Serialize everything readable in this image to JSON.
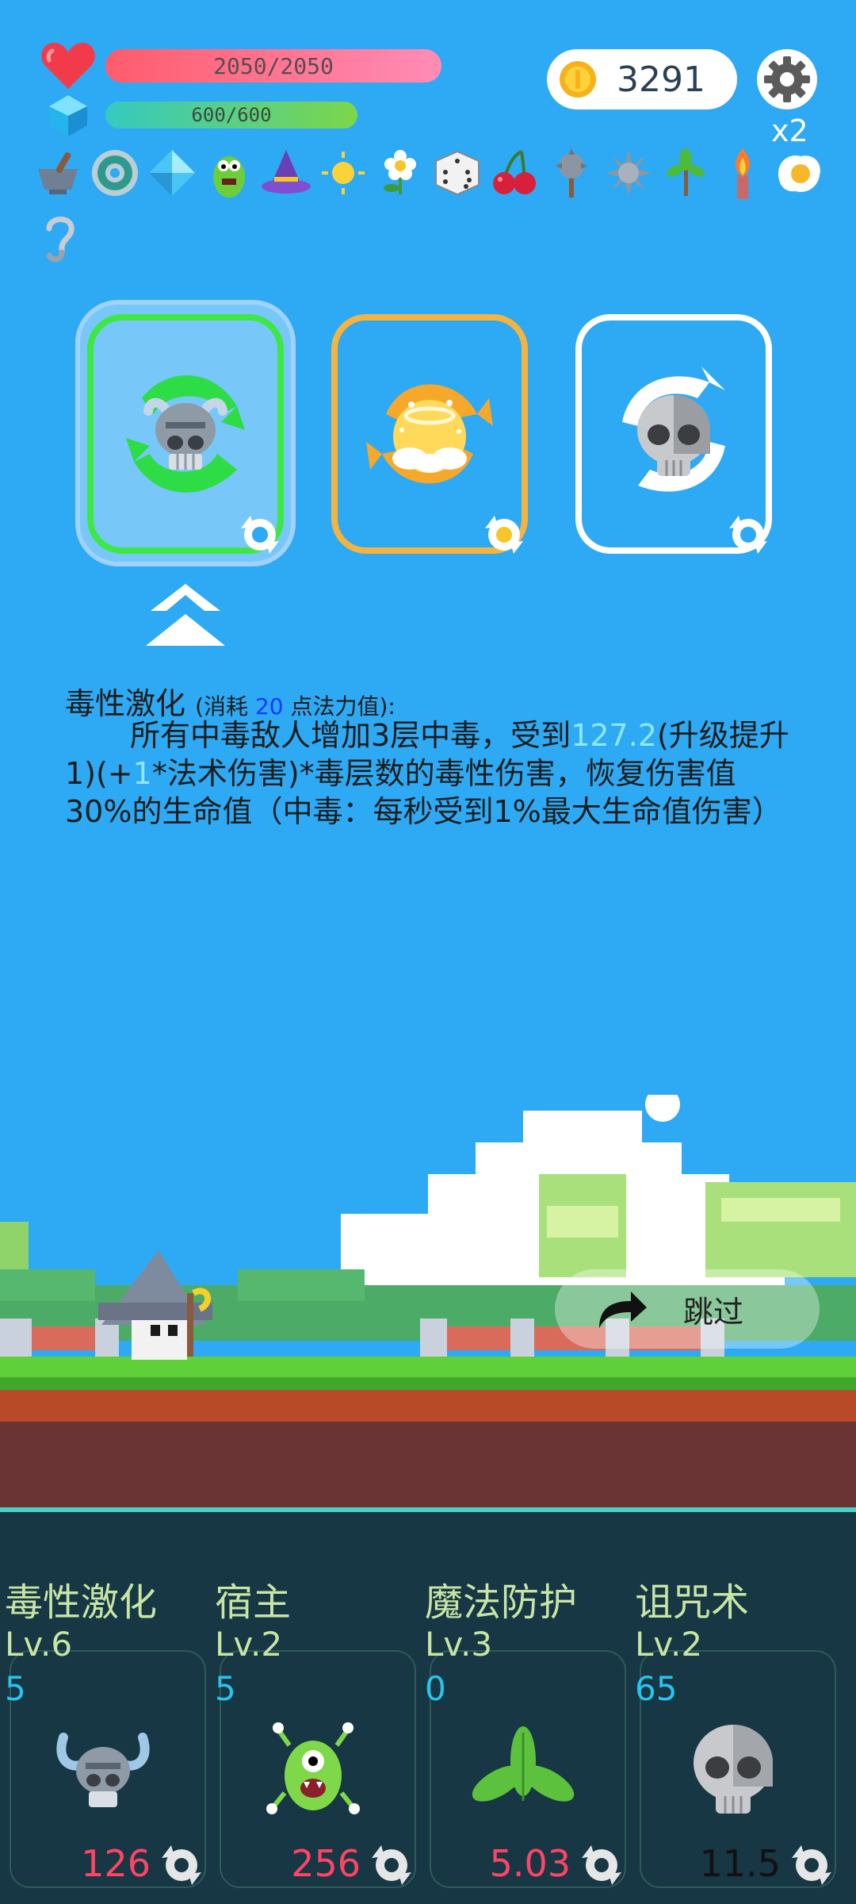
{
  "hud": {
    "hp_text": "2050/2050",
    "hp_fraction": 1.0,
    "mp_text": "600/600",
    "mp_fraction": 1.0,
    "coins": "3291",
    "multiplier": "x2"
  },
  "items": [
    "mortar-icon",
    "ring-icon",
    "gem-icon",
    "goblin-icon",
    "wizard-hat-icon",
    "sun-icon",
    "flower-icon",
    "dice-icon",
    "cherry-icon",
    "spiked-mace-icon",
    "spiked-ball-icon",
    "sapling-icon",
    "torch-icon",
    "egg-icon",
    "hook-icon"
  ],
  "choices": [
    {
      "name": "viking-skull-poison",
      "border": "#3ee844"
    },
    {
      "name": "halo-angel",
      "border": "#f4b43f"
    },
    {
      "name": "grey-skull",
      "border": "#ffffff"
    }
  ],
  "description": {
    "title": "毒性激化",
    "cost_prefix": "(消耗 ",
    "cost_value": "20",
    "cost_suffix": " 点法力值):",
    "body_1": "所有中毒敌人增加3层中毒，受到",
    "value_1": "127.2",
    "body_2": "(升级提升1)(+",
    "value_2": "1",
    "body_3": "*法术伤害)*毒层数的毒性伤害，恢复伤害值30%的生命值（中毒：每秒受到1%最大生命值伤害）"
  },
  "skip_label": "跳过",
  "cards": [
    {
      "name": "毒性激化",
      "level": "Lv.6",
      "count": "5",
      "stat": "126"
    },
    {
      "name": "宿主",
      "level": "Lv.2",
      "count": "5",
      "stat": "256"
    },
    {
      "name": "魔法防护",
      "level": "Lv.3",
      "count": "0",
      "stat": "5.03"
    },
    {
      "name": "诅咒术",
      "level": "Lv.2",
      "count": "65",
      "stat": "11.5"
    }
  ],
  "colors": {
    "sky": "#2ea9f4",
    "hp": "#ff6b7d",
    "mp": "#5fd07c",
    "panel": "#173744",
    "highlight": "#8ee8ff",
    "cost": "#1838ff"
  }
}
